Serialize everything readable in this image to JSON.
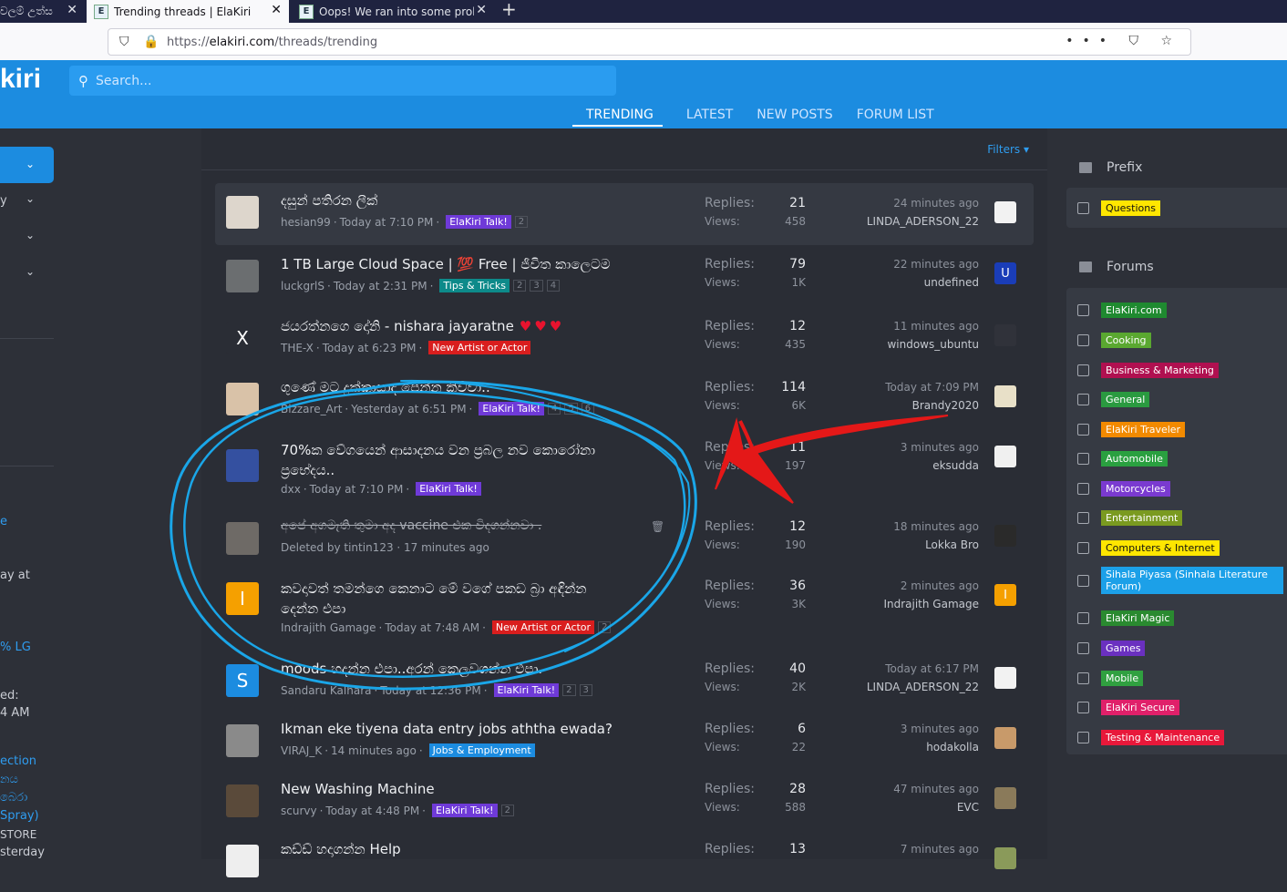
{
  "browser": {
    "tabs": [
      {
        "title": "වලම් උත්ස",
        "close": "✕"
      },
      {
        "title": "Trending threads | ElaKiri",
        "close": "✕",
        "active": true
      },
      {
        "title": "Oops! We ran into some proble",
        "close": "✕"
      }
    ],
    "new_tab": "+",
    "url_prefix": "https://",
    "url_host": "elakiri.com",
    "url_path": "/threads/trending",
    "url_actions": "••• ⛉ ☆"
  },
  "site": {
    "logo": "kiri",
    "search_placeholder": "Search...",
    "nav": [
      "TRENDING",
      "LATEST",
      "NEW POSTS",
      "FORUM LIST"
    ],
    "filters": "Filters ▾"
  },
  "left_fragments": [
    "y",
    "e",
    "ay at",
    "% LG",
    "ed:",
    "4 AM",
    "ection",
    "නය",
    "බෙරා",
    "Spray)",
    "STORE",
    "sterday"
  ],
  "threads": [
    {
      "title": "දසුන් පතිරන ලීක්",
      "author": "hesian99",
      "date": "Today at 7:10 PM",
      "label": "ElaKiri Talk!",
      "label_color": "#6f3ad8",
      "pages": [
        "2"
      ],
      "replies": "21",
      "views": "458",
      "last_time": "24 minutes ago",
      "last_user": "LINDA_ADERSON_22",
      "avatar_color": "#ddd6cc",
      "last_color": "#f2f2f2"
    },
    {
      "title": "1 TB Large Cloud Space | 💯 Free | ජීවිත කාලෙටම",
      "author": "luckgrlS",
      "date": "Today at 2:31 PM",
      "label": "Tips & Tricks",
      "label_color": "#0d8a8a",
      "pages": [
        "2",
        "3",
        "4"
      ],
      "replies": "79",
      "views": "1K",
      "last_time": "22 minutes ago",
      "last_user": "undefined",
      "avatar_color": "#6b6e70",
      "last_letter": "U",
      "last_color": "#1a3db8"
    },
    {
      "title": "ජයරත්නගෙ දෝනි - nishara jayaratne",
      "hearts": "♥♥♥",
      "author": "THE-X",
      "date": "Today at 6:23 PM",
      "label": "New Artist or Actor",
      "label_color": "#d91e1e",
      "pages": [],
      "replies": "12",
      "views": "435",
      "last_time": "11 minutes ago",
      "last_user": "windows_ubuntu",
      "avatar_letter": "X",
      "avatar_color": "#2a2d35",
      "last_color": "#30323a"
    },
    {
      "title": "ගුණේ මට දුක්කාසාද පෙන්න කිව්වා..",
      "author": "Bizzare_Art",
      "date": "Yesterday at 6:51 PM",
      "label": "ElaKiri Talk!",
      "label_color": "#6f3ad8",
      "pages": [
        "4",
        "5",
        "6"
      ],
      "replies": "114",
      "views": "6K",
      "last_time": "Today at 7:09 PM",
      "last_user": "Brandy2020",
      "avatar_color": "#d9c2a8",
      "last_color": "#e8e0c8"
    },
    {
      "title": "70%ක වේගයෙන් ආසාදනය වන ප්‍රබල නව කොරෝනා",
      "title2": "ප්‍රභේදය..",
      "author": "dxx",
      "date": "Today at 7:10 PM",
      "label": "ElaKiri Talk!",
      "label_color": "#6f3ad8",
      "pages": [],
      "replies": "11",
      "views": "197",
      "last_time": "3 minutes ago",
      "last_user": "eksudda",
      "avatar_color": "#3450a0",
      "last_color": "#f0f0f0"
    },
    {
      "title": "අපේ අගමැති තුමා අද vaccine එක විදගන්නවා .",
      "deleted_meta": "Deleted by tintin123 · 17 minutes ago",
      "trash": "🗑",
      "replies": "12",
      "views": "190",
      "last_time": "18 minutes ago",
      "last_user": "Lokka Bro",
      "avatar_color": "#6e6a66",
      "last_color": "#2a2a2a"
    },
    {
      "title": "කවදාවත් තමන්ගෙ කෙනාට මේ වගේ පකඩ බ්‍රා අඳින්න",
      "title2": "දෙන්න එපා",
      "author": "Indrajith Gamage",
      "date": "Today at 7:48 AM",
      "label": "New Artist or Actor",
      "label_color": "#d91e1e",
      "pages": [
        "2"
      ],
      "replies": "36",
      "views": "3K",
      "last_time": "2 minutes ago",
      "last_user": "Indrajith Gamage",
      "avatar_letter": "I",
      "avatar_color": "#f5a000",
      "last_letter": "I",
      "last_color": "#f5a000"
    },
    {
      "title": "moods හදන්න එපා..අරන් කෙලවගන්න එපා.",
      "author": "Sandaru Kalhara",
      "date": "Today at 12:36 PM",
      "label": "ElaKiri Talk!",
      "label_color": "#6f3ad8",
      "pages": [
        "2",
        "3"
      ],
      "replies": "40",
      "views": "2K",
      "last_time": "Today at 6:17 PM",
      "last_user": "LINDA_ADERSON_22",
      "avatar_letter": "S",
      "avatar_color": "#1c8ce0",
      "last_color": "#f2f2f2"
    },
    {
      "title": "Ikman eke tiyena data entry jobs aththa ewada?",
      "author": "VIRAJ_K",
      "date": "14 minutes ago",
      "label": "Jobs & Employment",
      "label_color": "#1c8ce0",
      "pages": [],
      "replies": "6",
      "views": "22",
      "last_time": "3 minutes ago",
      "last_user": "hodakolla",
      "avatar_color": "#8a8a8a",
      "last_color": "#c89a6a"
    },
    {
      "title": "New Washing Machine",
      "author": "scurvy",
      "date": "Today at 4:48 PM",
      "label": "ElaKiri Talk!",
      "label_color": "#6f3ad8",
      "pages": [
        "2"
      ],
      "replies": "28",
      "views": "588",
      "last_time": "47 minutes ago",
      "last_user": "EVC",
      "avatar_color": "#5a4a3a",
      "last_color": "#8a7a5a"
    },
    {
      "title": "කඩ්ඩ් හදාගන්න Help",
      "replies": "13",
      "last_time": "7 minutes ago",
      "avatar_color": "#eeeeee",
      "last_color": "#8a9a5a"
    }
  ],
  "labels": {
    "replies": "Replies:",
    "views": "Views:"
  },
  "sidebar": {
    "prefix_title": "Prefix",
    "prefix_items": [
      {
        "name": "Questions",
        "color": "#ffe600",
        "text_color": "#111"
      }
    ],
    "forums_title": "Forums",
    "forum_items": [
      {
        "name": "ElaKiri.com",
        "color": "#1f8a30"
      },
      {
        "name": "Cooking",
        "color": "#5aa830"
      },
      {
        "name": "Business & Marketing",
        "color": "#b01050"
      },
      {
        "name": "General",
        "color": "#2a9a40"
      },
      {
        "name": "ElaKiri Traveler",
        "color": "#f28a00"
      },
      {
        "name": "Automobile",
        "color": "#2aa040"
      },
      {
        "name": "Motorcycles",
        "color": "#7a3ad0"
      },
      {
        "name": "Entertainment",
        "color": "#7a9a20"
      },
      {
        "name": "Computers & Internet",
        "color": "#ffe600",
        "text_color": "#111"
      },
      {
        "name": "Sihala Piyasa (Sinhala Literature Forum)",
        "color": "#1ca0e8"
      },
      {
        "name": "ElaKiri Magic",
        "color": "#2a8a30"
      },
      {
        "name": "Games",
        "color": "#6a30c0"
      },
      {
        "name": "Mobile",
        "color": "#30a040"
      },
      {
        "name": "ElaKiri Secure",
        "color": "#e0206a"
      },
      {
        "name": "Testing & Maintenance",
        "color": "#e8183a"
      }
    ]
  },
  "annotation": {
    "circle_color": "#1aa6e8",
    "arrow_color": "#e41818"
  }
}
